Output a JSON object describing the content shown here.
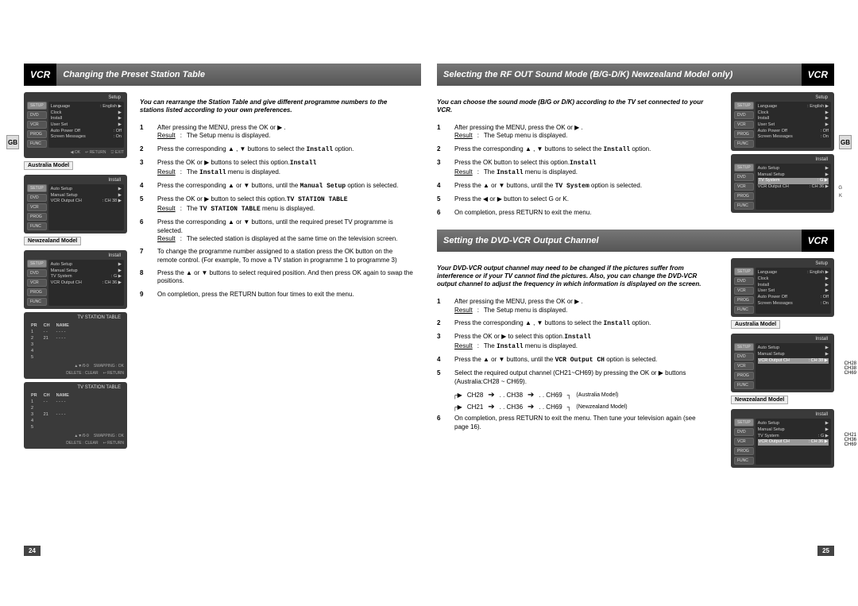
{
  "tag": "VCR",
  "gb": "GB",
  "page_left": "24",
  "page_right": "25",
  "left": {
    "title": "Changing the Preset Station Table",
    "intro": "You can rearrange the Station Table and give different programme numbers to the stations listed according to your own preferences.",
    "steps": [
      {
        "n": "1",
        "body": "After pressing the MENU, press the OK or ▶ .",
        "result": "The Setup menu is displayed."
      },
      {
        "n": "2",
        "body": "Press the corresponding ▲ , ▼ buttons to select the ",
        "bold": "Install",
        "tail": " option."
      },
      {
        "n": "3",
        "body": "Press the OK or ▶ buttons to select this option.",
        "result": "The ",
        "bold": "Install",
        "result_tail": " menu is displayed."
      },
      {
        "n": "4",
        "body": "Press the corresponding ▲ or ▼ buttons, until the ",
        "bold": "Manual Setup",
        "tail": " option is selected."
      },
      {
        "n": "5",
        "body": "Press the OK or ▶ button to select this option.",
        "result": "The ",
        "bold": "TV STATION TABLE",
        "result_tail": " menu is displayed."
      },
      {
        "n": "6",
        "body": "Press the corresponding ▲ or ▼ buttons, until the required preset TV programme is selected.",
        "result": "The selected station is displayed at the same time on the television screen."
      },
      {
        "n": "7",
        "body": "To change the programme number assigned to a station press the OK button on the remote control. (For example, To move a TV station in programme 1 to programme 3)"
      },
      {
        "n": "8",
        "body": "Press the ▲ or ▼ buttons to select required position. And then press OK again to swap the positions."
      },
      {
        "n": "9",
        "body": "On completion, press the RETURN button four times to exit the menu."
      }
    ],
    "model_labels": [
      "Australia Model",
      "Newzealand Model"
    ],
    "screens": {
      "setup": {
        "header": "Setup",
        "tabs": [
          "SETUP",
          "DVD",
          "VCR",
          "PROG",
          "FUNC"
        ],
        "lines": [
          {
            "l": "Language",
            "r": ": English  ▶"
          },
          {
            "l": "Clock",
            "r": "▶"
          },
          {
            "l": "Install",
            "r": "▶"
          },
          {
            "l": "User Set",
            "r": "▶"
          },
          {
            "l": "Auto Power Off",
            "r": ": Off"
          },
          {
            "l": "Screen Messages",
            "r": ": On"
          }
        ],
        "footer": [
          "▲▼",
          "◀ OK",
          "↩ RETURN",
          "⎋ EXIT"
        ]
      },
      "install_au": {
        "header": "Install",
        "lines": [
          {
            "l": "Auto Setup",
            "r": "▶"
          },
          {
            "l": "Manual Setup",
            "r": "▶"
          },
          {
            "l": "VCR Output CH",
            "r": ": CH 38  ▶"
          }
        ]
      },
      "install_nz": {
        "header": "Install",
        "lines": [
          {
            "l": "Auto Setup",
            "r": "▶"
          },
          {
            "l": "Manual Setup",
            "r": "▶"
          },
          {
            "l": "TV System",
            "r": ": G  ▶"
          },
          {
            "l": "VCR Output CH",
            "r": ": CH 36  ▶"
          }
        ]
      },
      "station1": {
        "header": "TV STATION TABLE",
        "cols": [
          "PR",
          "CH",
          "NAME"
        ],
        "rows": [
          [
            "1",
            "- -",
            "- - - -"
          ],
          [
            "2",
            "21",
            "- - - -"
          ],
          [
            "3",
            "",
            ""
          ],
          [
            "4",
            "",
            ""
          ],
          [
            "5",
            "",
            ""
          ]
        ],
        "footer": [
          "▲▼/0-9",
          "SWAPPING : OK",
          "DELETE : CLEAR",
          "↩ RETURN"
        ]
      },
      "station2": {
        "header": "TV STATION TABLE",
        "cols": [
          "PR",
          "CH",
          "NAME"
        ],
        "rows": [
          [
            "1",
            "- -",
            "- - - -"
          ],
          [
            "2",
            "",
            ""
          ],
          [
            "3",
            "21",
            "- - - -"
          ],
          [
            "4",
            "",
            ""
          ],
          [
            "5",
            "",
            ""
          ]
        ],
        "footer": [
          "▲▼/0-9",
          "SWAPPING : OK",
          "DELETE : CLEAR",
          "↩ RETURN"
        ]
      }
    }
  },
  "right_top": {
    "title": "Selecting the RF OUT Sound Mode (B/G-D/K) Newzealand Model only)",
    "intro": "You can choose the sound mode (B/G or D/K) according to the TV set connected to your VCR.",
    "steps": [
      {
        "n": "1",
        "body": "After pressing the MENU, press the OK or ▶ .",
        "result": "The Setup menu is displayed."
      },
      {
        "n": "2",
        "body": "Press the corresponding ▲ , ▼ buttons to select the ",
        "bold": "Install",
        "tail": " option."
      },
      {
        "n": "3",
        "body": "Press the OK button to select this option.",
        "result": "The ",
        "bold": "Install",
        "result_tail": " menu is displayed."
      },
      {
        "n": "4",
        "body": "Press the ▲ or ▼ buttons, until the ",
        "bold": "TV System",
        "tail": " option is selected."
      },
      {
        "n": "5",
        "body": "Press the ◀ or ▶ button to select G or K."
      },
      {
        "n": "6",
        "body": "On completion, press RETURN to exit the menu."
      }
    ],
    "annot_g": "G",
    "annot_k": "K"
  },
  "right_bottom": {
    "title": "Setting the DVD-VCR Output Channel",
    "intro": "Your DVD-VCR output channel may need to be changed if the pictures suffer from interference or if your TV cannot find the pictures. Also, you can change the DVD-VCR output channel to adjust the frequency in which information is displayed on the screen.",
    "steps": [
      {
        "n": "1",
        "body": "After pressing the MENU, press the OK or ▶ .",
        "result": "The Setup menu is displayed."
      },
      {
        "n": "2",
        "body": "Press the corresponding ▲ , ▼ buttons to select the ",
        "bold": "Install",
        "tail": " option."
      },
      {
        "n": "3",
        "body": "Press the OK or ▶ to select this option.",
        "result": "The ",
        "bold": "Install",
        "result_tail": " menu is displayed."
      },
      {
        "n": "4",
        "body": "Press the ▲ or ▼ buttons, until the ",
        "bold": "VCR Output CH",
        "tail": " option is selected."
      },
      {
        "n": "5",
        "body": "Select the required output channel (CH21~CH69) by pressing the OK or ▶ buttons (Australia:CH28 ~ CH69)."
      },
      {
        "n": "6",
        "body": "On completion, press RETURN to exit the menu. Then tune your television again (see page 16)."
      }
    ],
    "flow_au": [
      "CH28",
      ". . CH38",
      ". . CH69",
      "(Australia Model)"
    ],
    "flow_nz": [
      "CH21",
      ". . CH36",
      ". . CH69",
      "(Newzealand Model)"
    ],
    "model_labels": [
      "Australia Model",
      "Newzealand Model"
    ],
    "annot_au": [
      "CH28",
      "CH38",
      "CH69"
    ],
    "annot_nz": [
      "CH21",
      "CH36",
      "CH69"
    ]
  }
}
